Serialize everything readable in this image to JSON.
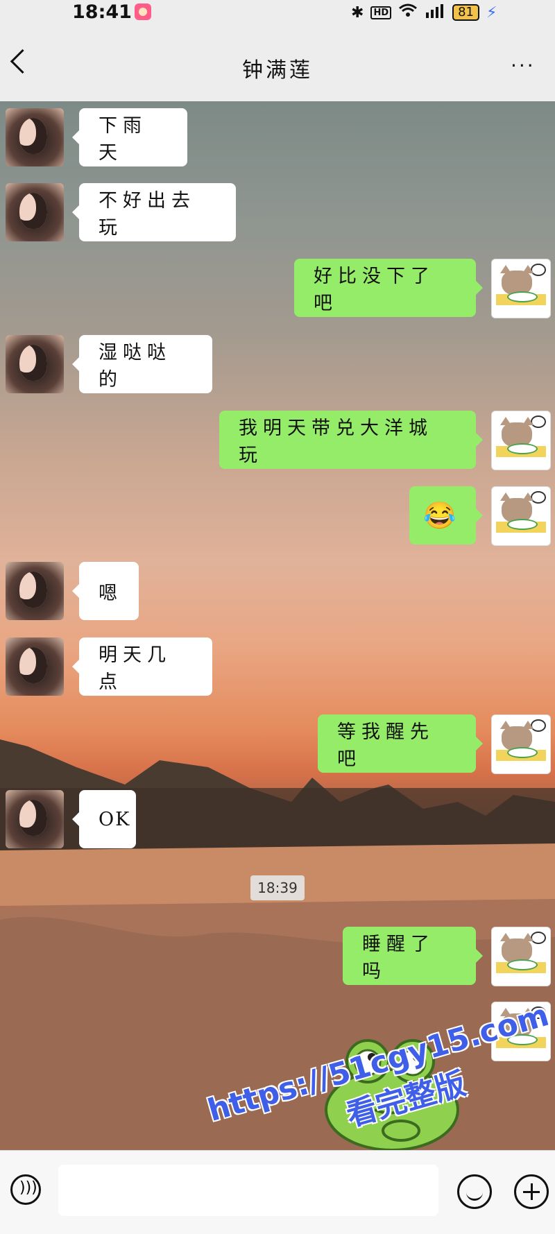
{
  "status_bar": {
    "time": "18:41",
    "battery": "81",
    "icons": [
      "bluetooth-icon",
      "hd-icon",
      "wifi-icon",
      "5g-signal-icon",
      "battery-icon",
      "charging-icon"
    ]
  },
  "header": {
    "title": "钟满莲",
    "more": "···"
  },
  "messages": [
    {
      "side": "left",
      "text": "下雨天"
    },
    {
      "side": "left",
      "text": "不好出去玩"
    },
    {
      "side": "right",
      "text": "好比没下了吧"
    },
    {
      "side": "left",
      "text": "湿哒哒的"
    },
    {
      "side": "right",
      "text": "我明天带兑大洋城玩"
    },
    {
      "side": "right",
      "text": "😂"
    },
    {
      "side": "left",
      "text": "嗯"
    },
    {
      "side": "left",
      "text": "明天几点"
    },
    {
      "side": "right",
      "text": "等我醒先吧"
    },
    {
      "side": "left",
      "text": "OK"
    },
    {
      "side": "right",
      "text": "睡醒了吗"
    }
  ],
  "timestamp": "18:39",
  "watermark": {
    "url": "https://51cgy15.com",
    "sub": "看完整版"
  },
  "colors": {
    "outgoing_bubble": "#95ec69",
    "incoming_bubble": "#ffffff",
    "watermark": "#3f5fe8"
  }
}
